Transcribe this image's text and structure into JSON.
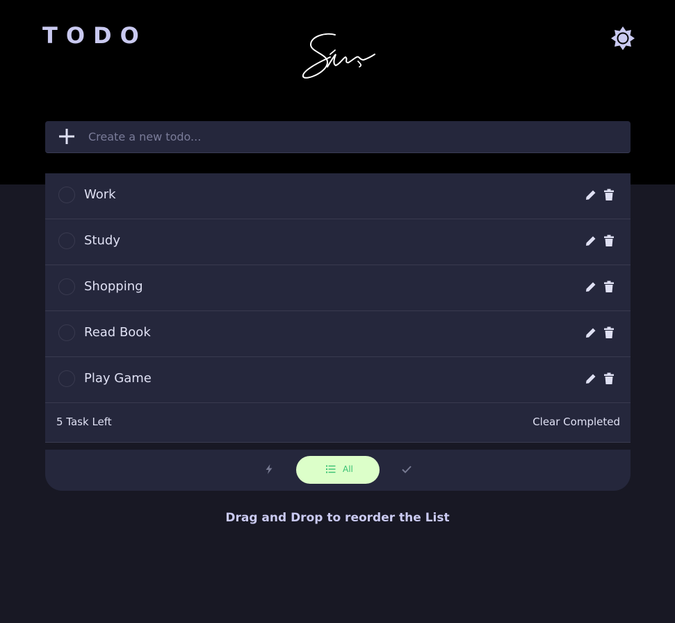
{
  "header": {
    "title": "TODO",
    "signature": "Siza",
    "settings_icon": "settings-icon"
  },
  "new_todo": {
    "placeholder": "Create a new todo...",
    "add_icon": "plus-icon"
  },
  "todos": [
    {
      "label": "Work",
      "completed": false
    },
    {
      "label": "Study",
      "completed": false
    },
    {
      "label": "Shopping",
      "completed": false
    },
    {
      "label": "Read Book",
      "completed": false
    },
    {
      "label": "Play Game",
      "completed": false
    }
  ],
  "footer": {
    "tasks_left": "5 Task Left",
    "clear_completed": "Clear Completed"
  },
  "filters": {
    "active_icon": "bolt-icon",
    "all_label": "All",
    "all_icon": "list-icon",
    "completed_icon": "check-icon",
    "selected": "All"
  },
  "hint": "Drag and Drop to reorder the List",
  "colors": {
    "accent": "#c9c9f0",
    "card": "#25273c",
    "background": "#181824",
    "hero": "#000000",
    "filter_active_bg": "#dcffc9",
    "filter_active_fg": "#38c172"
  }
}
